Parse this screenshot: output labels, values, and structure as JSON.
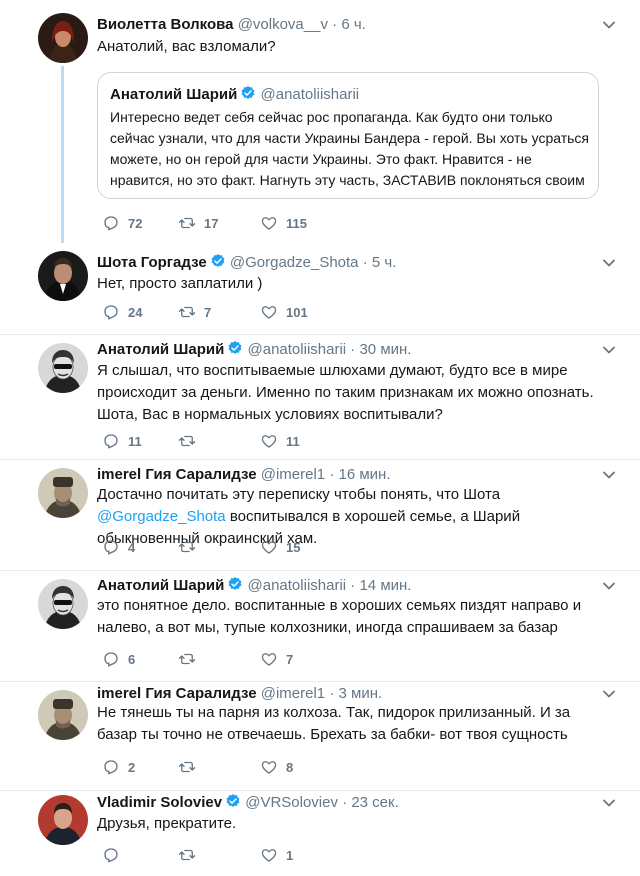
{
  "tweets": [
    {
      "name": "Виолетта Волкова",
      "handle": "@volkova__v",
      "time": "6 ч.",
      "verified": false,
      "text": "Анатолий, вас взломали?",
      "quote": {
        "name": "Анатолий Шарий",
        "handle": "@anatoliisharii",
        "verified": true,
        "text": "Интересно ведет себя сейчас рос пропаганда. Как будто они только сейчас узнали, что для части Украины  Бандера - герой. Вы хоть усраться можете, но он герой для части Украины. Это факт. Нравится - не нравится, но это факт. Нагнуть эту часть, ЗАСТАВИВ поклоняться своим"
      },
      "replies": "72",
      "retweets": "17",
      "likes": "115"
    },
    {
      "name": "Шота Горгадзе",
      "handle": "@Gorgadze_Shota",
      "time": "5 ч.",
      "verified": true,
      "text": "Нет, просто заплатили )",
      "replies": "24",
      "retweets": "7",
      "likes": "101"
    },
    {
      "name": "Анатолий Шарий",
      "handle": "@anatoliisharii",
      "time": "30 мин.",
      "verified": true,
      "text": "Я слышал, что воспитываемые шлюхами думают, будто все в мире происходит за деньги. Именно по таким признакам их можно опознать. Шота, Вас в нормальных условиях воспитывали?",
      "replies": "11",
      "retweets": "",
      "likes": "11"
    },
    {
      "name": "imerel Гия Саралидзе",
      "handle": "@imerel1",
      "time": "16 мин.",
      "verified": false,
      "text_before": "Достачно почитать эту переписку чтобы понять, что Шота ",
      "mention": "@Gorgadze_Shota",
      "text_after": " воспитывался в хорошей семье, а Шарий обыкновенный окраинский хам.",
      "replies": "4",
      "retweets": "",
      "likes": "15"
    },
    {
      "name": "Анатолий Шарий",
      "handle": "@anatoliisharii",
      "time": "14 мин.",
      "verified": true,
      "text": "это понятное дело. воспитанные в хороших семьях пиздят направо и налево, а вот мы, тупые колхозники, иногда спрашиваем за базар",
      "replies": "6",
      "retweets": "",
      "likes": "7"
    },
    {
      "name": "imerel Гия Саралидзе",
      "handle": "@imerel1",
      "time": "3 мин.",
      "verified": false,
      "text": "Не тянешь ты на парня из колхоза. Так, пидорок прилизанный. И за базар ты точно не отвечаешь. Брехать за бабки- вот твоя сущность",
      "replies": "2",
      "retweets": "",
      "likes": "8"
    },
    {
      "name": "Vladimir Soloviev",
      "handle": "@VRSoloviev",
      "time": "23 сек.",
      "verified": true,
      "text": "Друзья, прекратите.",
      "replies": "",
      "retweets": "",
      "likes": "1"
    }
  ],
  "separator": "·",
  "colors": {
    "accent": "#1da1f2",
    "muted": "#657786",
    "thread": "#b8dcf7"
  },
  "icons": {
    "reply": "reply-icon",
    "retweet": "retweet-icon",
    "like": "heart-icon",
    "more": "chevron-down-icon",
    "verified": "verified-badge-icon"
  }
}
